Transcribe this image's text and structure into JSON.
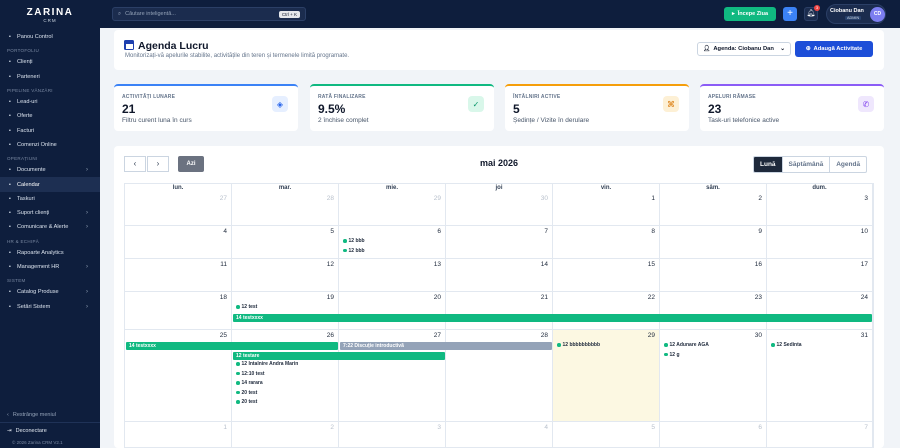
{
  "sidebar": {
    "logo": "ZARINA",
    "logo_sub": "CRM",
    "sections": [
      {
        "title": "",
        "items": [
          {
            "label": "Panou Control",
            "icon": "dashboard-icon",
            "arrow": false,
            "active": false
          }
        ]
      },
      {
        "title": "PORTOFOLIU",
        "items": [
          {
            "label": "Clienți",
            "icon": "user-icon",
            "arrow": false,
            "active": false
          },
          {
            "label": "Parteneri",
            "icon": "handshake-icon",
            "arrow": false,
            "active": false
          }
        ]
      },
      {
        "title": "PIPELINE VÂNZĂRI",
        "items": [
          {
            "label": "Lead-uri",
            "icon": "megaphone-icon",
            "arrow": false,
            "active": false
          },
          {
            "label": "Oferte",
            "icon": "file-icon",
            "arrow": false,
            "active": false
          },
          {
            "label": "Facturi",
            "icon": "invoice-icon",
            "arrow": false,
            "active": false
          },
          {
            "label": "Comenzi Online",
            "icon": "cart-icon",
            "arrow": false,
            "active": false
          }
        ]
      },
      {
        "title": "OPERAȚIUNI",
        "items": [
          {
            "label": "Documente",
            "icon": "folder-icon",
            "arrow": true,
            "active": false
          },
          {
            "label": "Calendar",
            "icon": "calendar-icon",
            "arrow": false,
            "active": true
          },
          {
            "label": "Taskuri",
            "icon": "task-icon",
            "arrow": false,
            "active": false
          },
          {
            "label": "Suport clienți",
            "icon": "headset-icon",
            "arrow": true,
            "active": false
          },
          {
            "label": "Comunicare & Alerte",
            "icon": "bell-icon",
            "arrow": true,
            "active": false
          }
        ]
      },
      {
        "title": "HR & ECHIPĂ",
        "items": [
          {
            "label": "Rapoarte Analytics",
            "icon": "chart-icon",
            "arrow": false,
            "active": false
          },
          {
            "label": "Management HR",
            "icon": "team-icon",
            "arrow": true,
            "active": false
          }
        ]
      },
      {
        "title": "SISTEM",
        "items": [
          {
            "label": "Catalog Produse",
            "icon": "box-icon",
            "arrow": true,
            "active": false
          },
          {
            "label": "Setări Sistem",
            "icon": "gear-icon",
            "arrow": true,
            "active": false
          }
        ]
      }
    ],
    "collapse_label": "Restrânge meniul",
    "logout_label": "Deconectare",
    "version": "© 2026 Zarina CRM V2.1"
  },
  "topbar": {
    "search_placeholder": "Căutare inteligentă...",
    "search_shortcut": "Ctrl + K",
    "start_label": "Începe Ziua",
    "notif_count": "3",
    "user_name": "Ciobanu Dan",
    "user_role": "ADMIN",
    "user_initials": "CD"
  },
  "header": {
    "title": "Agenda Lucru",
    "subtitle": "Monitorizați-vă apelurile stabilite, activitățile din teren și termenele limită programate.",
    "agenda_select": "Agenda: Ciobanu Dan",
    "add_label": "Adaugă Activitate"
  },
  "stats": [
    {
      "label": "ACTIVITĂȚI LUNARE",
      "value": "21",
      "desc": "Filtru curent luna în curs",
      "color": "#3b82f6",
      "icon": "layers-icon",
      "icon_bg": "#e6efff",
      "icon_color": "#2563eb",
      "glyph": "◈"
    },
    {
      "label": "RATĂ FINALIZARE",
      "value": "9.5%",
      "desc": "2 închise complet",
      "color": "#10b981",
      "icon": "check-double-icon",
      "icon_bg": "#d9f7ea",
      "icon_color": "#059669",
      "glyph": "✓"
    },
    {
      "label": "ÎNTÂLNIRI ACTIVE",
      "value": "5",
      "desc": "Ședințe / Vizite în derulare",
      "color": "#f59e0b",
      "icon": "handshake-icon",
      "icon_bg": "#fdf0d5",
      "icon_color": "#d97706",
      "glyph": "⌘"
    },
    {
      "label": "APELURI RĂMASE",
      "value": "23",
      "desc": "Task-uri telefonice active",
      "color": "#8b5cf6",
      "icon": "phone-icon",
      "icon_bg": "#efe7fd",
      "icon_color": "#7c3aed",
      "glyph": "✆"
    }
  ],
  "calendar": {
    "today_label": "Azi",
    "month": "mai 2026",
    "views": [
      "Lună",
      "Săptămână",
      "Agendă"
    ],
    "weekdays": [
      "lun.",
      "mar.",
      "mie.",
      "joi",
      "vin.",
      "sâm.",
      "dum."
    ],
    "weeks": [
      [
        {
          "n": "27",
          "o": true
        },
        {
          "n": "28",
          "o": true
        },
        {
          "n": "29",
          "o": true
        },
        {
          "n": "30",
          "o": true
        },
        {
          "n": "1",
          "o": false
        },
        {
          "n": "2",
          "o": false
        },
        {
          "n": "3",
          "o": false
        }
      ],
      [
        {
          "n": "4",
          "o": false
        },
        {
          "n": "5",
          "o": false
        },
        {
          "n": "6",
          "o": false
        },
        {
          "n": "7",
          "o": false
        },
        {
          "n": "8",
          "o": false
        },
        {
          "n": "9",
          "o": false
        },
        {
          "n": "10",
          "o": false
        }
      ],
      [
        {
          "n": "11",
          "o": false
        },
        {
          "n": "12",
          "o": false
        },
        {
          "n": "13",
          "o": false
        },
        {
          "n": "14",
          "o": false
        },
        {
          "n": "15",
          "o": false
        },
        {
          "n": "16",
          "o": false
        },
        {
          "n": "17",
          "o": false
        }
      ],
      [
        {
          "n": "18",
          "o": false
        },
        {
          "n": "19",
          "o": false
        },
        {
          "n": "20",
          "o": false
        },
        {
          "n": "21",
          "o": false
        },
        {
          "n": "22",
          "o": false
        },
        {
          "n": "23",
          "o": false
        },
        {
          "n": "24",
          "o": false
        }
      ],
      [
        {
          "n": "25",
          "o": false
        },
        {
          "n": "26",
          "o": false
        },
        {
          "n": "27",
          "o": false
        },
        {
          "n": "28",
          "o": false
        },
        {
          "n": "29",
          "o": false,
          "today": true
        },
        {
          "n": "30",
          "o": false
        },
        {
          "n": "31",
          "o": false
        }
      ],
      [
        {
          "n": "1",
          "o": true
        },
        {
          "n": "2",
          "o": true
        },
        {
          "n": "3",
          "o": true
        },
        {
          "n": "4",
          "o": true
        },
        {
          "n": "5",
          "o": true
        },
        {
          "n": "6",
          "o": true
        },
        {
          "n": "7",
          "o": true
        }
      ]
    ],
    "dot_events": [
      {
        "week": 1,
        "day": 2,
        "slot": 0,
        "label": "12 bbb"
      },
      {
        "week": 1,
        "day": 2,
        "slot": 1,
        "label": "12 bbb"
      },
      {
        "week": 3,
        "day": 1,
        "slot": 0,
        "label": "12 test"
      },
      {
        "week": 4,
        "day": 4,
        "slot": 0,
        "label": "12 bbbbbbbbbb"
      },
      {
        "week": 4,
        "day": 5,
        "slot": 0,
        "label": "12 Adunare AGA"
      },
      {
        "week": 4,
        "day": 5,
        "slot": 1,
        "label": "12 g"
      },
      {
        "week": 4,
        "day": 6,
        "slot": 0,
        "label": "12 Sedinta"
      },
      {
        "week": 4,
        "day": 1,
        "slot": 2,
        "label": "12 Intalnire Andra Marin"
      },
      {
        "week": 4,
        "day": 1,
        "slot": 3,
        "label": "12:10 test"
      },
      {
        "week": 4,
        "day": 1,
        "slot": 4,
        "label": "14 rarara"
      },
      {
        "week": 4,
        "day": 1,
        "slot": 5,
        "label": "20 test"
      },
      {
        "week": 4,
        "day": 1,
        "slot": 6,
        "label": "20 test"
      }
    ],
    "bar_events": [
      {
        "week": 3,
        "start": 1,
        "end": 7,
        "slot": 1,
        "label": "14 testxxxx",
        "color": "#10b981"
      },
      {
        "week": 4,
        "start": 0,
        "end": 2,
        "slot": 0,
        "label": "14 testxxxx",
        "color": "#10b981"
      },
      {
        "week": 4,
        "start": 2,
        "end": 4,
        "slot": 0,
        "label": "7:22 Discuție introductivă",
        "color": "#94a3b8"
      },
      {
        "week": 4,
        "start": 1,
        "end": 3,
        "slot": 1,
        "label": "12 testare",
        "color": "#10b981"
      }
    ]
  }
}
